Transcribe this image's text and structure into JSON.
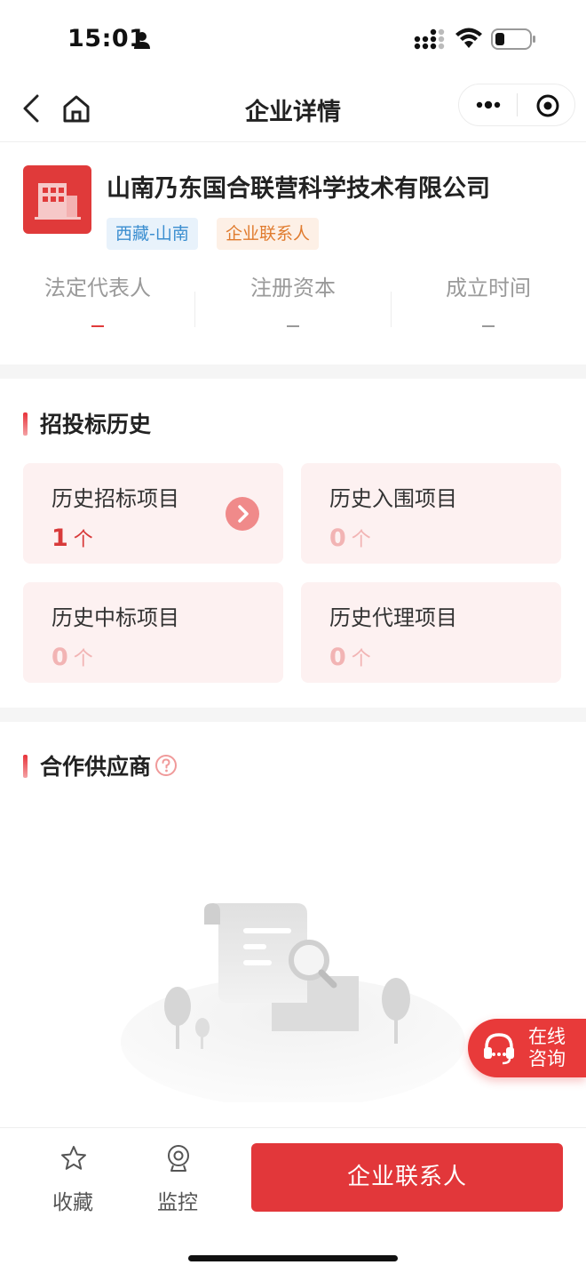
{
  "status_bar": {
    "time": "15:01"
  },
  "nav": {
    "title": "企业详情"
  },
  "company": {
    "name": "山南乃东国合联营科学技术有限公司",
    "tags": [
      "西藏-山南",
      "企业联系人"
    ],
    "stats": [
      {
        "label": "法定代表人",
        "value": "-",
        "color": "#e03a3a"
      },
      {
        "label": "注册资本",
        "value": "-",
        "color": "#999999"
      },
      {
        "label": "成立时间",
        "value": "-",
        "color": "#999999"
      }
    ]
  },
  "bid_history": {
    "title": "招投标历史",
    "cards": [
      {
        "label": "历史招标项目",
        "count": "1",
        "unit": "个"
      },
      {
        "label": "历史入围项目",
        "count": "0",
        "unit": "个"
      },
      {
        "label": "历史中标项目",
        "count": "0",
        "unit": "个"
      },
      {
        "label": "历史代理项目",
        "count": "0",
        "unit": "个"
      }
    ]
  },
  "suppliers": {
    "title": "合作供应商"
  },
  "float_button": {
    "label_line1": "在线",
    "label_line2": "咨询"
  },
  "tabbar": {
    "favorite_label": "收藏",
    "monitor_label": "监控",
    "contact_button": "企业联系人"
  },
  "colors": {
    "accent": "#e2373a",
    "card_bg": "#fdf1f1",
    "tag_region": "#3b8ed0",
    "tag_contact": "#e07b2e"
  },
  "icons": {
    "status": [
      "person-icon",
      "signal-icon",
      "wifi-icon",
      "battery-icon"
    ],
    "nav": [
      "back-icon",
      "home-icon",
      "more-icon",
      "target-icon"
    ],
    "tabbar": [
      "star-icon",
      "camera-icon"
    ],
    "float": "headset-icon"
  }
}
